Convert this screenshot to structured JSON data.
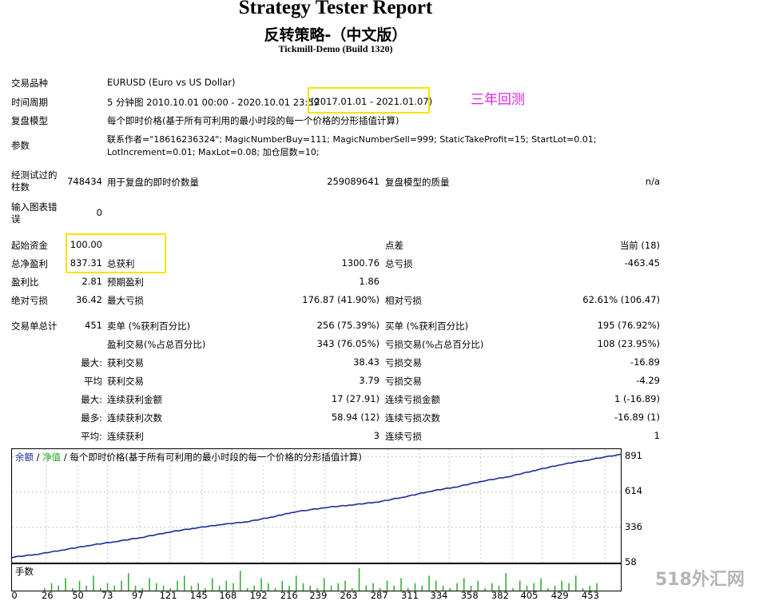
{
  "header": {
    "title": "Strategy Tester Report",
    "subtitle": "反转策略-（中文版）",
    "server": "Tickmill-Demo (Build 1320)"
  },
  "settings": {
    "symbol_label": "交易品种",
    "symbol_value": "EURUSD (Euro vs US Dollar)",
    "period_label": "时间周期",
    "period_value": "5 分钟图 2010.10.01 00:00 - 2020.10.01 23:59",
    "period_highlight": "(2017.01.01 - 2021.01.07)",
    "annotation": "三年回测",
    "model_label": "复盘模型",
    "model_value": "每个即时价格(基于所有可利用的最小时段的每一个价格的分形插值计算)",
    "params_label": "参数",
    "params_line1": "联系作者=\"18616236324\"; MagicNumberBuy=111; MagicNumberSell=999; StaticTakeProfit=15; StartLot=0.01;",
    "params_line2": "LotIncrement=0.01; MaxLot=0.08; 加仓层数=10;"
  },
  "test_info": {
    "bars_label": "经测试过的柱数",
    "bars_value": "748434",
    "ticks_label": "用于复盘的即时价数量",
    "ticks_value": "259089641",
    "quality_label": "复盘模型的质量",
    "quality_value": "n/a",
    "errors_label": "输入图表错误",
    "errors_value": "0"
  },
  "results": {
    "initial_deposit_label": "起始资金",
    "initial_deposit": "100.00",
    "spread_label": "点差",
    "spread_value": "当前 (18)",
    "net_profit_label": "总净盈利",
    "net_profit": "837.31",
    "gross_profit_label": "总获利",
    "gross_profit": "1300.76",
    "gross_loss_label": "总亏损",
    "gross_loss": "-463.45",
    "profit_factor_label": "盈利比",
    "profit_factor": "2.81",
    "expected_payoff_label": "预期盈利",
    "expected_payoff": "1.86",
    "abs_drawdown_label": "绝对亏损",
    "abs_drawdown": "36.42",
    "max_drawdown_label": "最大亏损",
    "max_drawdown": "176.87 (41.90%)",
    "rel_drawdown_label": "相对亏损",
    "rel_drawdown": "62.61% (106.47)"
  },
  "trades": {
    "total_label": "交易单总计",
    "total_value": "451",
    "short_label": "卖单 (%获利百分比)",
    "short_value": "256 (75.39%)",
    "long_label": "买单 (%获利百分比)",
    "long_value": "195 (76.92%)",
    "profit_trades_label": "盈利交易(%占总百分比)",
    "profit_trades_value": "343 (76.05%)",
    "loss_trades_label": "亏损交易(%占总百分比)",
    "loss_trades_value": "108 (23.95%)",
    "largest_prefix": "最大:",
    "largest_profit_label": "获利交易",
    "largest_profit": "38.43",
    "largest_loss_label": "亏损交易",
    "largest_loss": "-16.89",
    "average_prefix": "平均",
    "average_profit_label": "获利交易",
    "average_profit": "3.79",
    "average_loss_label": "亏损交易",
    "average_loss": "-4.29",
    "max1_prefix": "最大:",
    "max_consec_wins_label": "连续获利金额",
    "max_consec_wins": "17 (27.91)",
    "max_consec_losses_label": "连续亏损金额",
    "max_consec_losses": "1 (-16.89)",
    "max2_prefix": "最多:",
    "max_consec_profit_label": "连续获利次数",
    "max_consec_profit": "58.94 (12)",
    "max_consec_loss_label": "连续亏损次数",
    "max_consec_loss": "-16.89 (1)",
    "avg2_prefix": "平均:",
    "avg_consec_wins_label": "连续获利",
    "avg_consec_wins": "3",
    "avg_consec_losses_label": "连续亏损",
    "avg_consec_losses": "1"
  },
  "chart": {
    "legend_balance": "余额",
    "legend_sep1": " / ",
    "legend_equity": "净值",
    "legend_sep2": " / ",
    "legend_desc": "每个即时价格(基于所有可利用的最小时段的每一个价格的分形插值计算)",
    "volume_label": "手数",
    "watermark": "518外汇网",
    "colors": {
      "balance": "#1c2a9c",
      "equity": "#1aa31a",
      "volume": "#2ea82e",
      "grid": "#c8c8c8",
      "highlight": "#f7e400",
      "annotation": "#e020e0"
    }
  },
  "chart_data": {
    "type": "line",
    "ylim": [
      58,
      950
    ],
    "yticks": [
      58,
      336,
      614,
      891
    ],
    "xlim": [
      0,
      465
    ],
    "xticks": [
      0,
      26,
      50,
      73,
      97,
      121,
      145,
      168,
      192,
      216,
      239,
      263,
      287,
      311,
      334,
      358,
      382,
      405,
      429,
      453
    ],
    "series": [
      {
        "name": "余额",
        "x": [
          0,
          20,
          40,
          60,
          80,
          100,
          120,
          140,
          160,
          180,
          200,
          215,
          240,
          260,
          280,
          300,
          320,
          340,
          360,
          380,
          400,
          420,
          440,
          465
        ],
        "y": [
          100,
          125,
          160,
          195,
          225,
          258,
          298,
          330,
          358,
          380,
          420,
          455,
          492,
          512,
          536,
          575,
          620,
          655,
          700,
          735,
          785,
          830,
          865,
          910
        ]
      }
    ],
    "volume": [
      1,
      3,
      2,
      5,
      1,
      4,
      2,
      6,
      1,
      3,
      2,
      4,
      7,
      2,
      1,
      5,
      3,
      2,
      1,
      4,
      6,
      2,
      3,
      1,
      5,
      2,
      4,
      3,
      8,
      1,
      2,
      5,
      3,
      1,
      4,
      2,
      6,
      3,
      2,
      1,
      5,
      2,
      3,
      4,
      1,
      9,
      2,
      3,
      1,
      4,
      2,
      5,
      1,
      3,
      2,
      6,
      4,
      2,
      1,
      3,
      5,
      2,
      4,
      1,
      3,
      2,
      7,
      1,
      4,
      2,
      3,
      5,
      1,
      2,
      4,
      3,
      6,
      1,
      2,
      3
    ]
  }
}
